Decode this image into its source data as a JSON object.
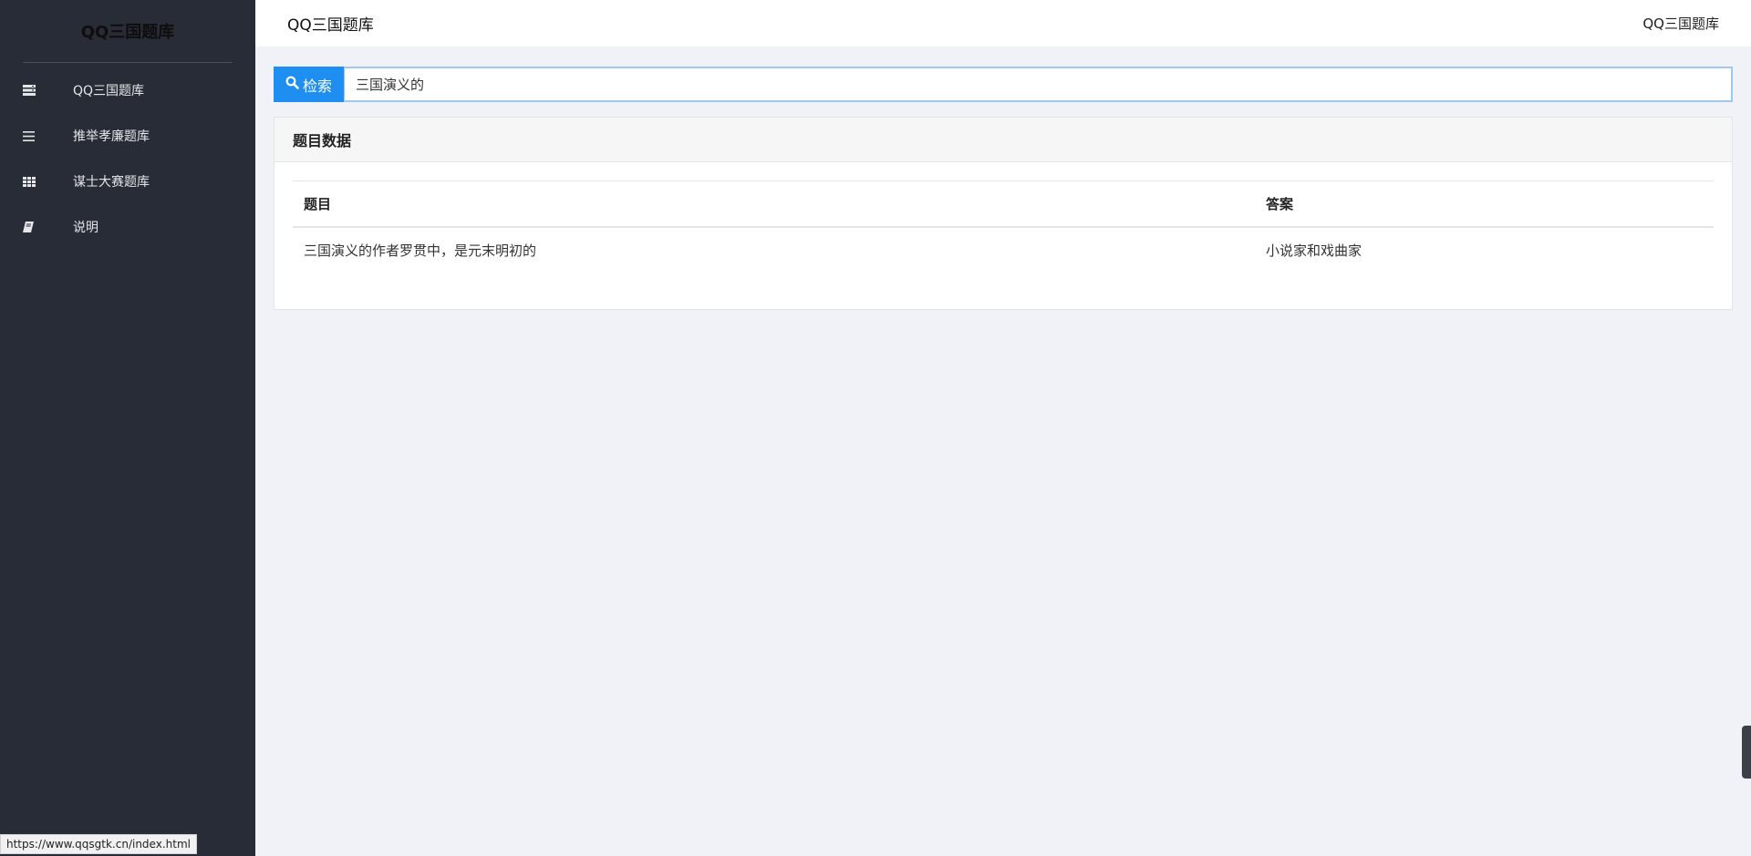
{
  "sidebar": {
    "brand": "QQ三国题库",
    "items": [
      {
        "label": "QQ三国题库",
        "icon": "server-icon"
      },
      {
        "label": "推举孝廉题库",
        "icon": "list-icon"
      },
      {
        "label": "谋士大赛题库",
        "icon": "grid-icon"
      },
      {
        "label": "说明",
        "icon": "book-icon"
      }
    ]
  },
  "topbar": {
    "title": "QQ三国题库",
    "user": "QQ三国题库"
  },
  "search": {
    "button_label": "检索",
    "value": "三国演义的"
  },
  "panel": {
    "title": "题目数据",
    "columns": [
      "题目",
      "答案"
    ],
    "rows": [
      {
        "question": "三国演义的作者罗贯中，是元末明初的",
        "answer": "小说家和戏曲家"
      }
    ]
  },
  "status_bar": {
    "url": "https://www.qqsgtk.cn/index.html"
  },
  "colors": {
    "sidebar_bg": "#282c36",
    "accent": "#1e8ff0",
    "page_bg": "#f0f2f7"
  }
}
